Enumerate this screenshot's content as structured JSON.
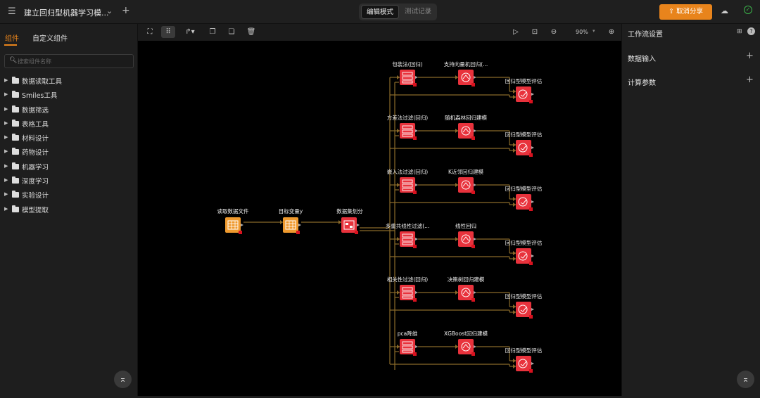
{
  "header": {
    "title": "建立回归型机器学习模...",
    "modes": [
      "编辑模式",
      "测试记录"
    ],
    "share_label": "取消分享"
  },
  "sidebar": {
    "tabs": [
      "组件",
      "自定义组件"
    ],
    "search_placeholder": "搜索组件名称",
    "folders": [
      "数据读取工具",
      "Smiles工具",
      "数据筛选",
      "表格工具",
      "材料设计",
      "药物设计",
      "机器学习",
      "深度学习",
      "实验设计",
      "模型提取"
    ]
  },
  "toolbar": {
    "zoom": "90%"
  },
  "right_panel": {
    "title": "工作流设置",
    "sections": [
      "数据输入",
      "计算参数"
    ]
  },
  "canvas": {
    "main_nodes": [
      "读取数据文件",
      "目标变量y",
      "数据集划分"
    ],
    "branches": [
      {
        "filter": "包装法(回归)",
        "model": "支持向量机回归(...",
        "eval": "回归型模型评估"
      },
      {
        "filter": "方差法过滤(回归)",
        "model": "随机森林回归建模",
        "eval": "回归型模型评估"
      },
      {
        "filter": "嵌入法过滤(回归)",
        "model": "K近邻回归建模",
        "eval": "回归型模型评估"
      },
      {
        "filter": "多重共线性过滤(...",
        "model": "线性回归",
        "eval": "回归型模型评估"
      },
      {
        "filter": "相关性过滤(回归)",
        "model": "决策树回归建模",
        "eval": "回归型模型评估"
      },
      {
        "filter": "pca降维",
        "model": "XGBoost回归建模",
        "eval": "回归型模型评估"
      }
    ]
  },
  "colors": {
    "accent": "#e8841c",
    "node_orange": "#ef9a2e",
    "node_red": "#e8323c",
    "edge": "#8a6a2a",
    "canvas_bg": "#000000"
  }
}
